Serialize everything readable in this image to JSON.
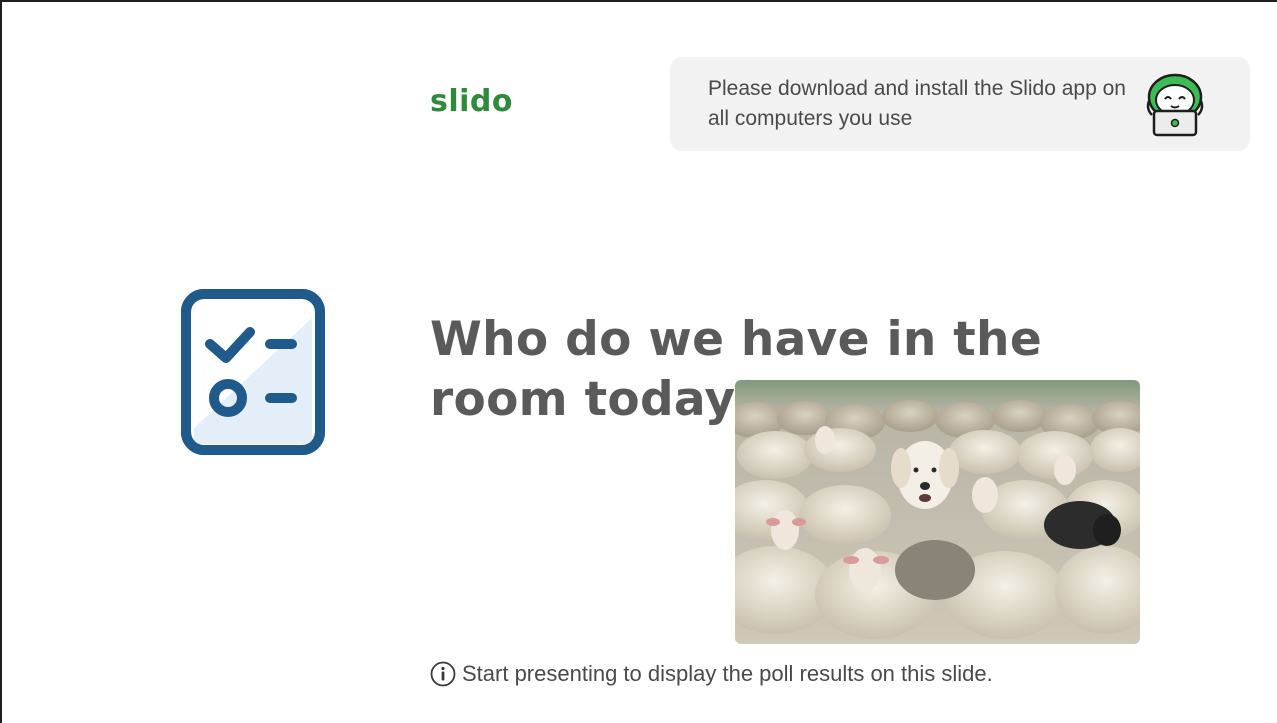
{
  "brand": {
    "logo_text": "slido",
    "brand_color": "#2f8a3a"
  },
  "banner": {
    "message": "Please download and install the Slido app on all computers you use",
    "mascot_icon": "slido-mascot-laptop-icon"
  },
  "poll": {
    "icon": "poll-checklist-icon",
    "icon_color": "#1f5a8a",
    "question": "Who do we have in the room today?"
  },
  "image": {
    "subject": "sheep-flock-with-dog-photo"
  },
  "footer": {
    "icon": "info-icon",
    "note": "Start presenting to display the poll results on this slide."
  }
}
